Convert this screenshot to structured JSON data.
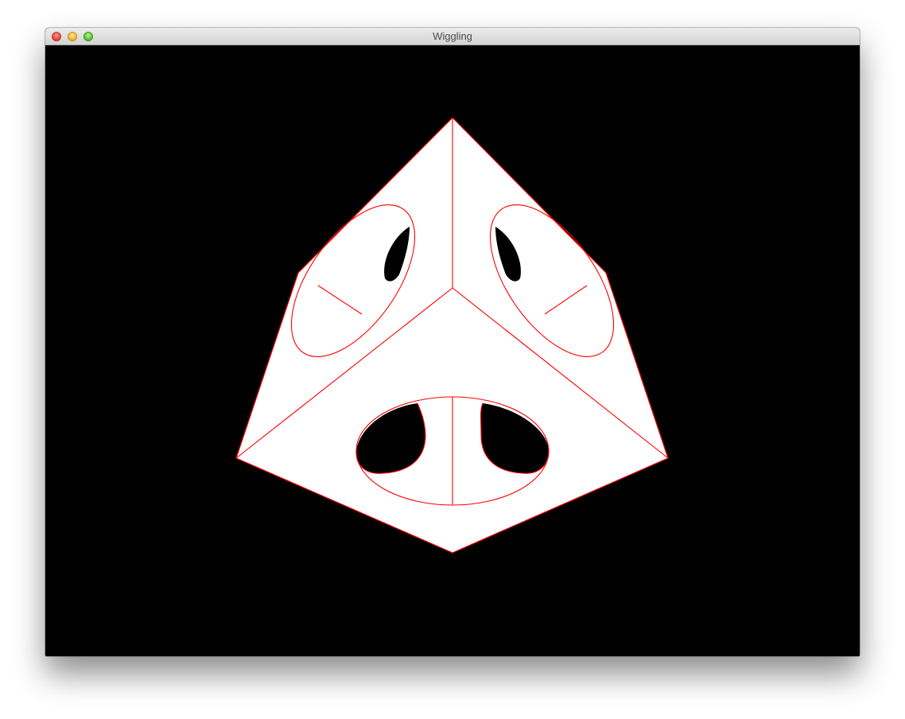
{
  "window": {
    "title": "Wiggling"
  },
  "scene": {
    "background_color": "#000000",
    "surface_color": "#ffffff",
    "edge_color": "#ff0000",
    "hole_color": "#000000"
  }
}
